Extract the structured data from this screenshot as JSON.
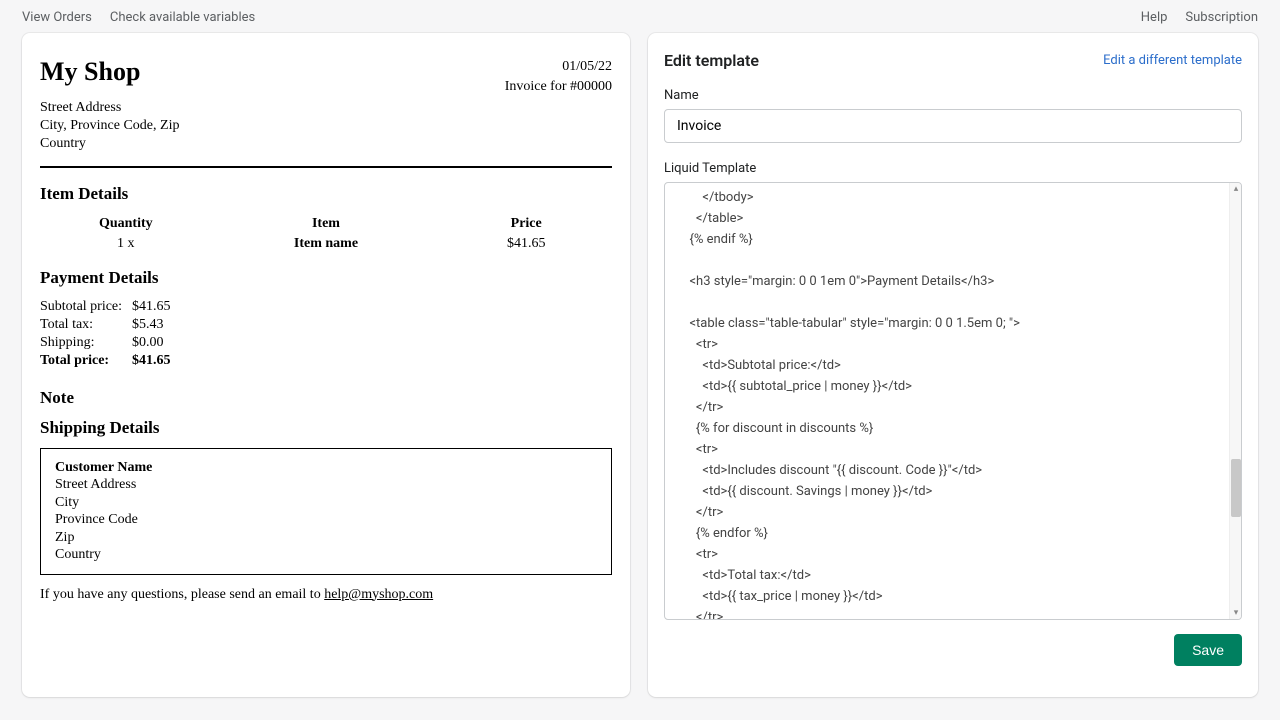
{
  "topbar": {
    "left": {
      "view_orders": "View Orders",
      "check_vars": "Check available variables"
    },
    "right": {
      "help": "Help",
      "subscription": "Subscription"
    }
  },
  "preview": {
    "shop_name": "My Shop",
    "date": "01/05/22",
    "invoice_for": "Invoice for #00000",
    "address": {
      "street": "Street Address",
      "city_line": "City, Province Code, Zip",
      "country": "Country"
    },
    "item_details_heading": "Item Details",
    "item_headers": {
      "qty": "Quantity",
      "item": "Item",
      "price": "Price"
    },
    "item_row": {
      "qty": "1 x",
      "item": "Item name",
      "price": "$41.65"
    },
    "payment_heading": "Payment Details",
    "payment": {
      "subtotal_label": "Subtotal price:",
      "subtotal": "$41.65",
      "tax_label": "Total tax:",
      "tax": "$5.43",
      "shipping_label": "Shipping:",
      "shipping": "$0.00",
      "total_label": "Total price:",
      "total": "$41.65"
    },
    "note_heading": "Note",
    "shipping_heading": "Shipping Details",
    "shipping": {
      "customer": "Customer Name",
      "street": "Street Address",
      "city": "City",
      "province": "Province Code",
      "zip": "Zip",
      "country": "Country"
    },
    "footer_text": "If you have any questions, please send an email to ",
    "footer_email": "help@myshop.com"
  },
  "editor": {
    "title": "Edit template",
    "link": "Edit a different template",
    "name_label": "Name",
    "name_value": "Invoice",
    "liquid_label": "Liquid Template",
    "code": "      </tbody>\n    </table>\n  {% endif %}\n\n  <h3 style=\"margin: 0 0 1em 0\">Payment Details</h3>\n\n  <table class=\"table-tabular\" style=\"margin: 0 0 1.5em 0; \">\n    <tr>\n      <td>Subtotal price:</td>\n      <td>{{ subtotal_price | money }}</td>\n    </tr>\n    {% for discount in discounts %}\n    <tr>\n      <td>Includes discount \"{{ discount. Code }}\"</td>\n      <td>{{ discount. Savings | money }}</td>\n    </tr>\n    {% endfor %}\n    <tr>\n      <td>Total tax:</td>\n      <td>{{ tax_price | money }}</td>\n    </tr>\n    <tr>",
    "save": "Save"
  }
}
